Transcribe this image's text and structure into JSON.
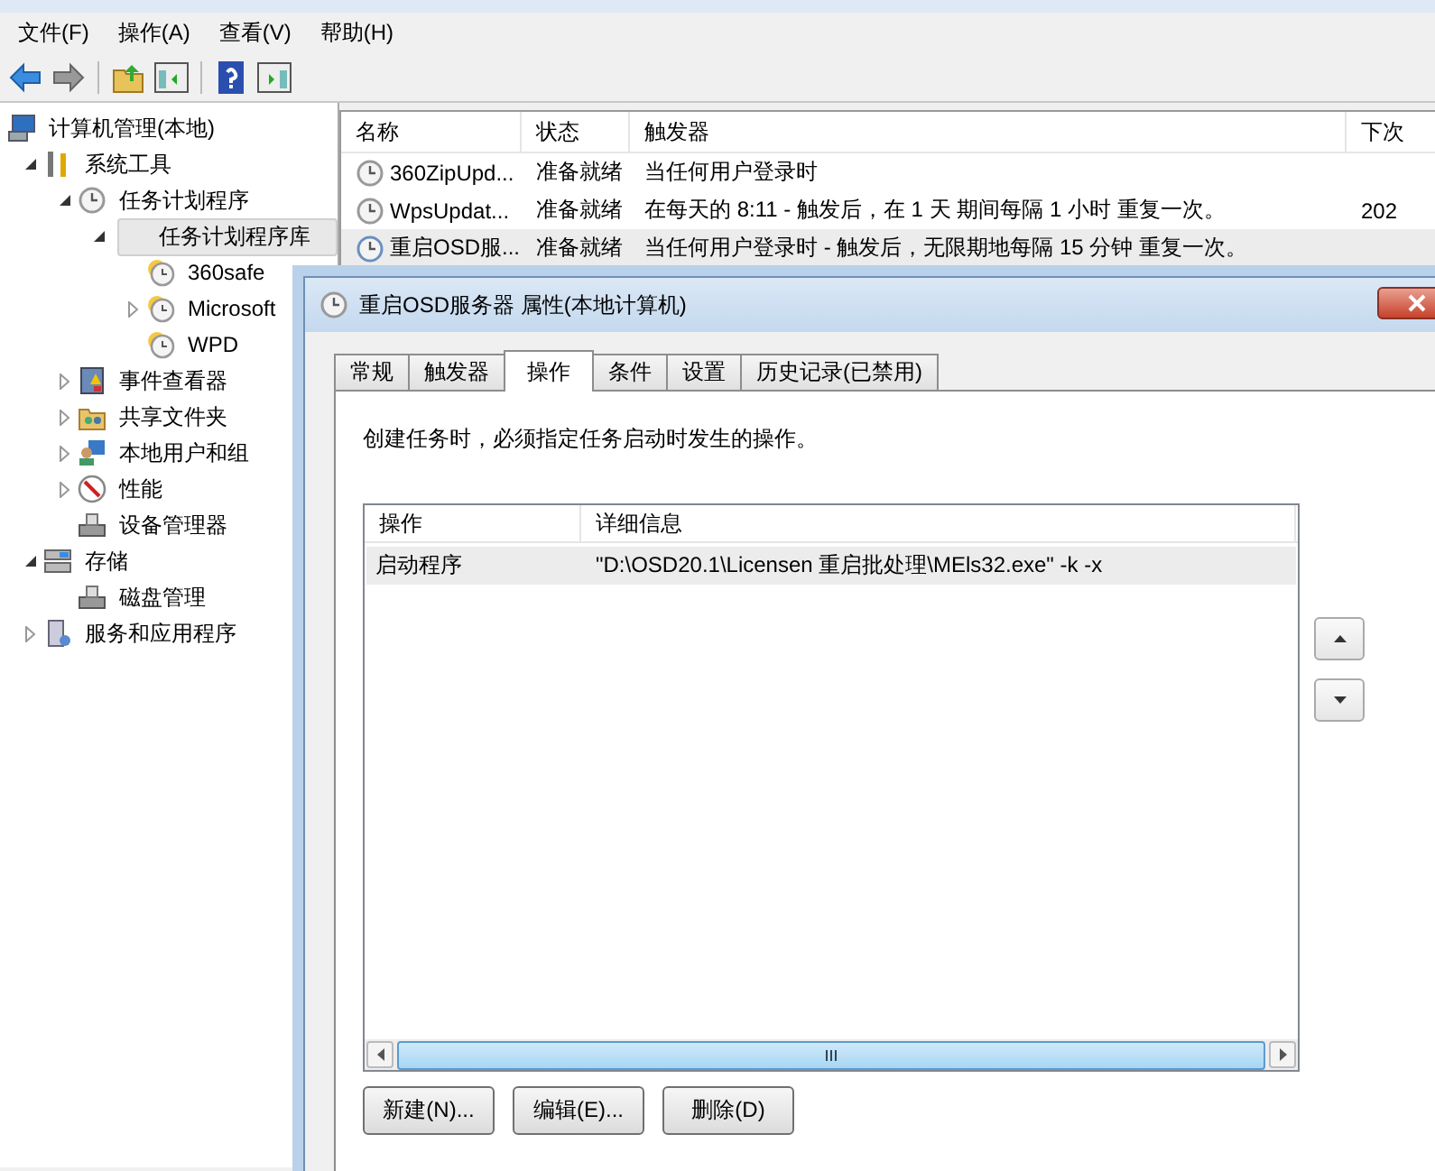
{
  "menu": [
    "文件(F)",
    "操作(A)",
    "查看(V)",
    "帮助(H)"
  ],
  "tree": [
    {
      "label": "计算机管理(本地)",
      "kind": "computer",
      "children": [
        {
          "label": "系统工具",
          "kind": "tools",
          "expanded": true,
          "children": [
            {
              "label": "任务计划程序",
              "kind": "clock",
              "expanded": true,
              "children": [
                {
                  "label": "任务计划程序库",
                  "expanded": true,
                  "selected": true,
                  "children": [
                    {
                      "label": "360safe",
                      "kind": "task-folder"
                    },
                    {
                      "label": "Microsoft",
                      "kind": "task-folder",
                      "expanded": false
                    },
                    {
                      "label": "WPD",
                      "kind": "task-folder"
                    }
                  ]
                }
              ]
            },
            {
              "label": "事件查看器",
              "kind": "log",
              "expanded": false
            },
            {
              "label": "共享文件夹",
              "kind": "share",
              "expanded": false
            },
            {
              "label": "本地用户和组",
              "kind": "users",
              "expanded": false
            },
            {
              "label": "性能",
              "kind": "gauge",
              "expanded": false
            },
            {
              "label": "设备管理器",
              "kind": "device"
            }
          ]
        },
        {
          "label": "存储",
          "kind": "storage",
          "expanded": true,
          "children": [
            {
              "label": "磁盘管理",
              "kind": "device"
            }
          ]
        },
        {
          "label": "服务和应用程序",
          "kind": "server",
          "expanded": false
        }
      ]
    }
  ],
  "task_table": {
    "columns": [
      "名称",
      "状态",
      "触发器",
      "下次"
    ],
    "rows": [
      {
        "name": "360ZipUpd...",
        "status": "准备就绪",
        "trigger": "当任何用户登录时",
        "selected": false
      },
      {
        "name": "WpsUpdat...",
        "status": "准备就绪",
        "trigger": "在每天的 8:11 - 触发后，在 1 天 期间每隔 1 小时 重复一次。",
        "next": "202",
        "selected": false
      },
      {
        "name": "重启OSD服...",
        "status": "准备就绪",
        "trigger": "当任何用户登录时 - 触发后，无限期地每隔 15 分钟 重复一次。",
        "selected": true
      }
    ]
  },
  "dialog": {
    "title": "重启OSD服务器 属性(本地计算机)",
    "tabs": [
      {
        "label": "常规",
        "selected": false
      },
      {
        "label": "触发器",
        "selected": false
      },
      {
        "label": "操作",
        "selected": true
      },
      {
        "label": "条件",
        "selected": false
      },
      {
        "label": "设置",
        "selected": false
      },
      {
        "label": "历史记录(已禁用)",
        "selected": false
      }
    ],
    "description": "创建任务时，必须指定任务启动时发生的操作。",
    "actions_table": {
      "columns": [
        "操作",
        "详细信息"
      ],
      "rows": [
        {
          "action": "启动程序",
          "details": "\"D:\\OSD20.1\\Licensen 重启批处理\\MEls32.exe\" -k -x",
          "selected": true
        }
      ]
    },
    "buttons": [
      "新建(N)...",
      "编辑(E)...",
      "删除(D)"
    ]
  }
}
